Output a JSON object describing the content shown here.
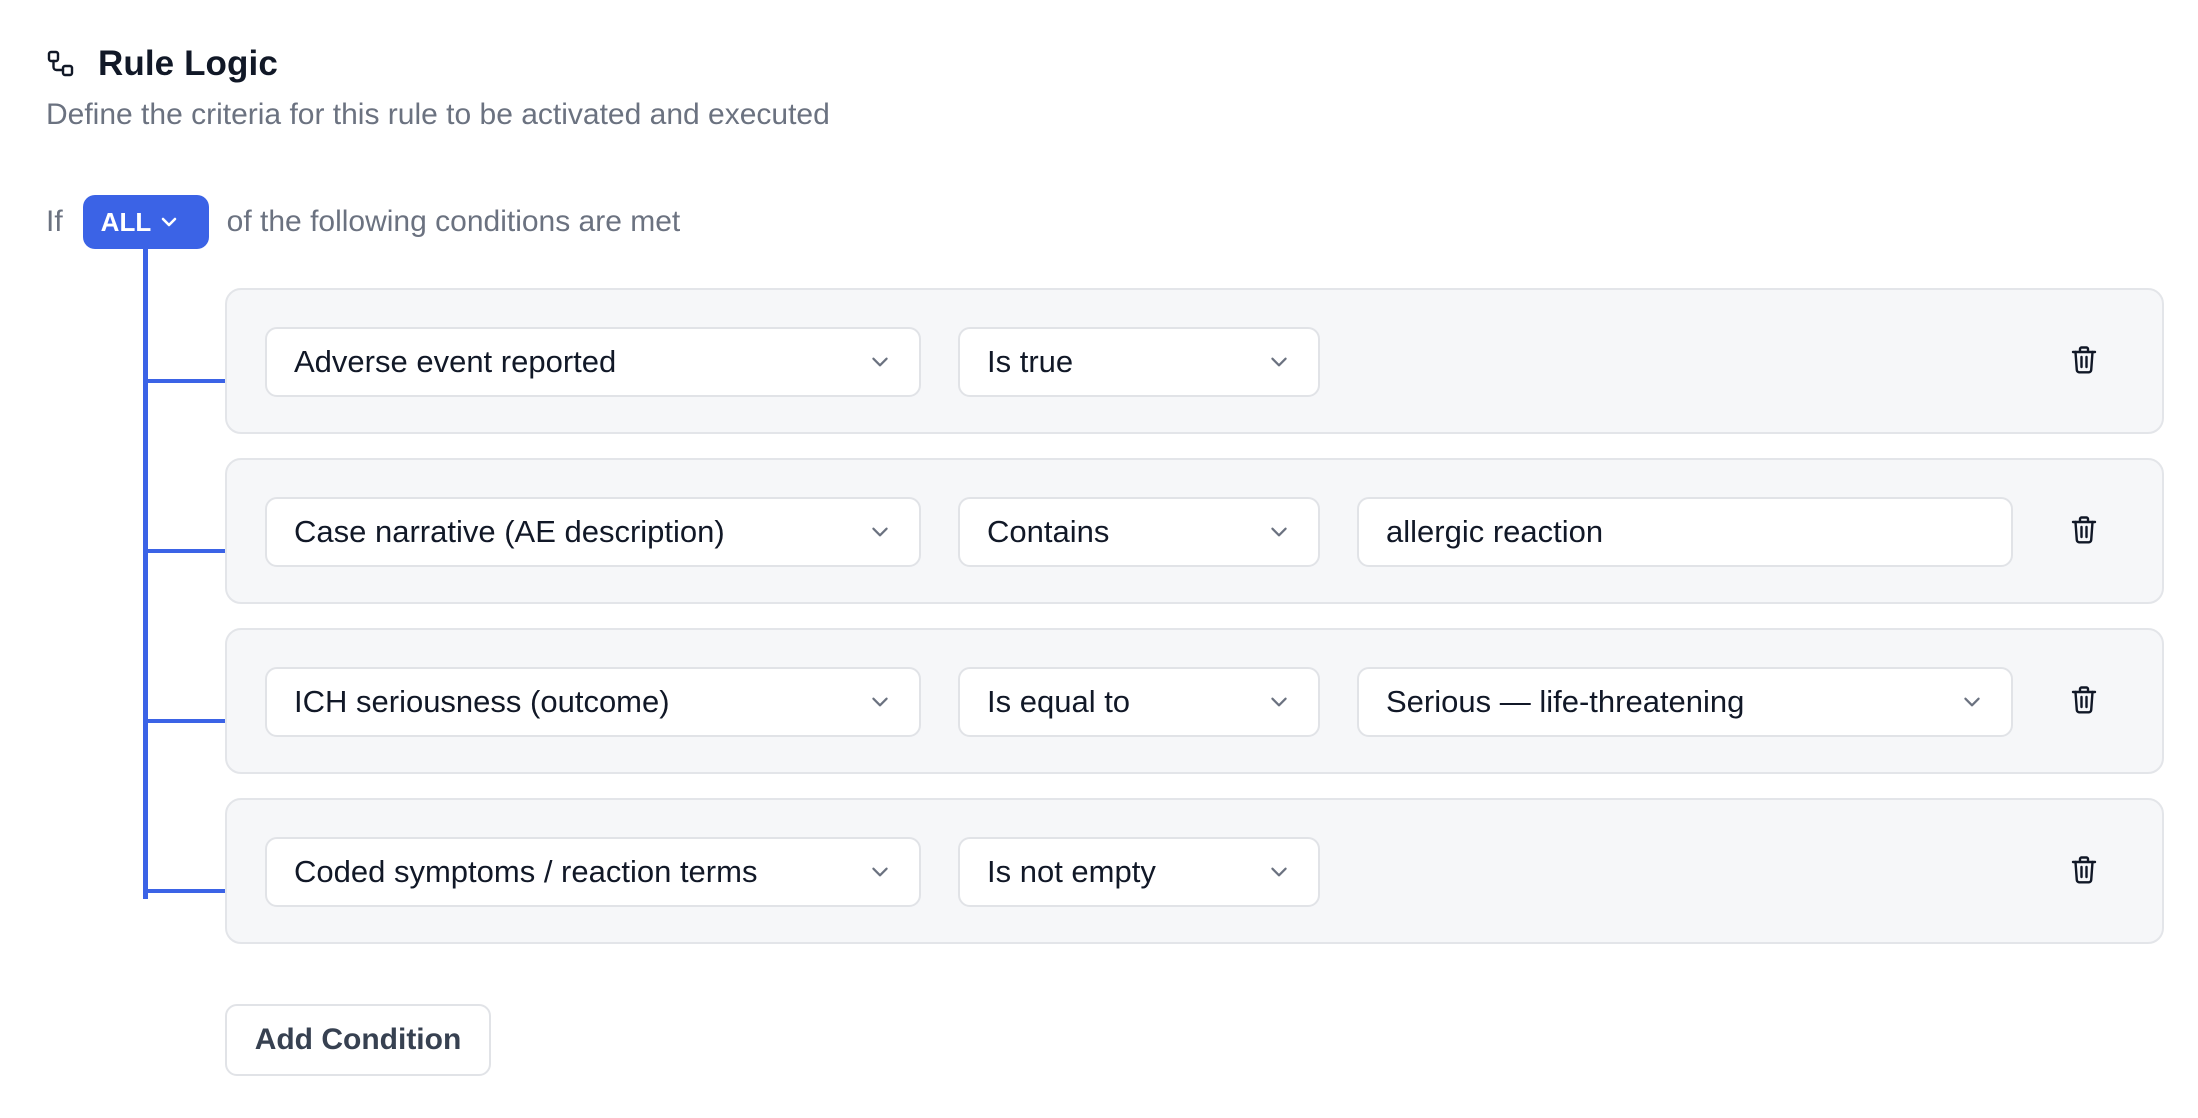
{
  "header": {
    "icon": "rule-logic-icon",
    "title": "Rule Logic",
    "subtitle": "Define the criteria for this rule to be activated and executed"
  },
  "match": {
    "prefix": "If",
    "selected": "ALL",
    "suffix": "of the following conditions are met"
  },
  "colors": {
    "accent": "#3b63e6",
    "row_bg": "#f6f7f9",
    "muted_text": "#6b7280"
  },
  "conditions": [
    {
      "field": "Adverse event reported",
      "operator": "Is true",
      "value": null,
      "value_type": "none"
    },
    {
      "field": "Case narrative (AE description)",
      "operator": "Contains",
      "value": "allergic reaction",
      "value_type": "text"
    },
    {
      "field": "ICH seriousness (outcome)",
      "operator": "Is equal to",
      "value": "Serious — life-threatening",
      "value_type": "select"
    },
    {
      "field": "Coded symptoms / reaction terms",
      "operator": "Is not empty",
      "value": null,
      "value_type": "none"
    }
  ],
  "add_button": {
    "label": "Add Condition"
  }
}
